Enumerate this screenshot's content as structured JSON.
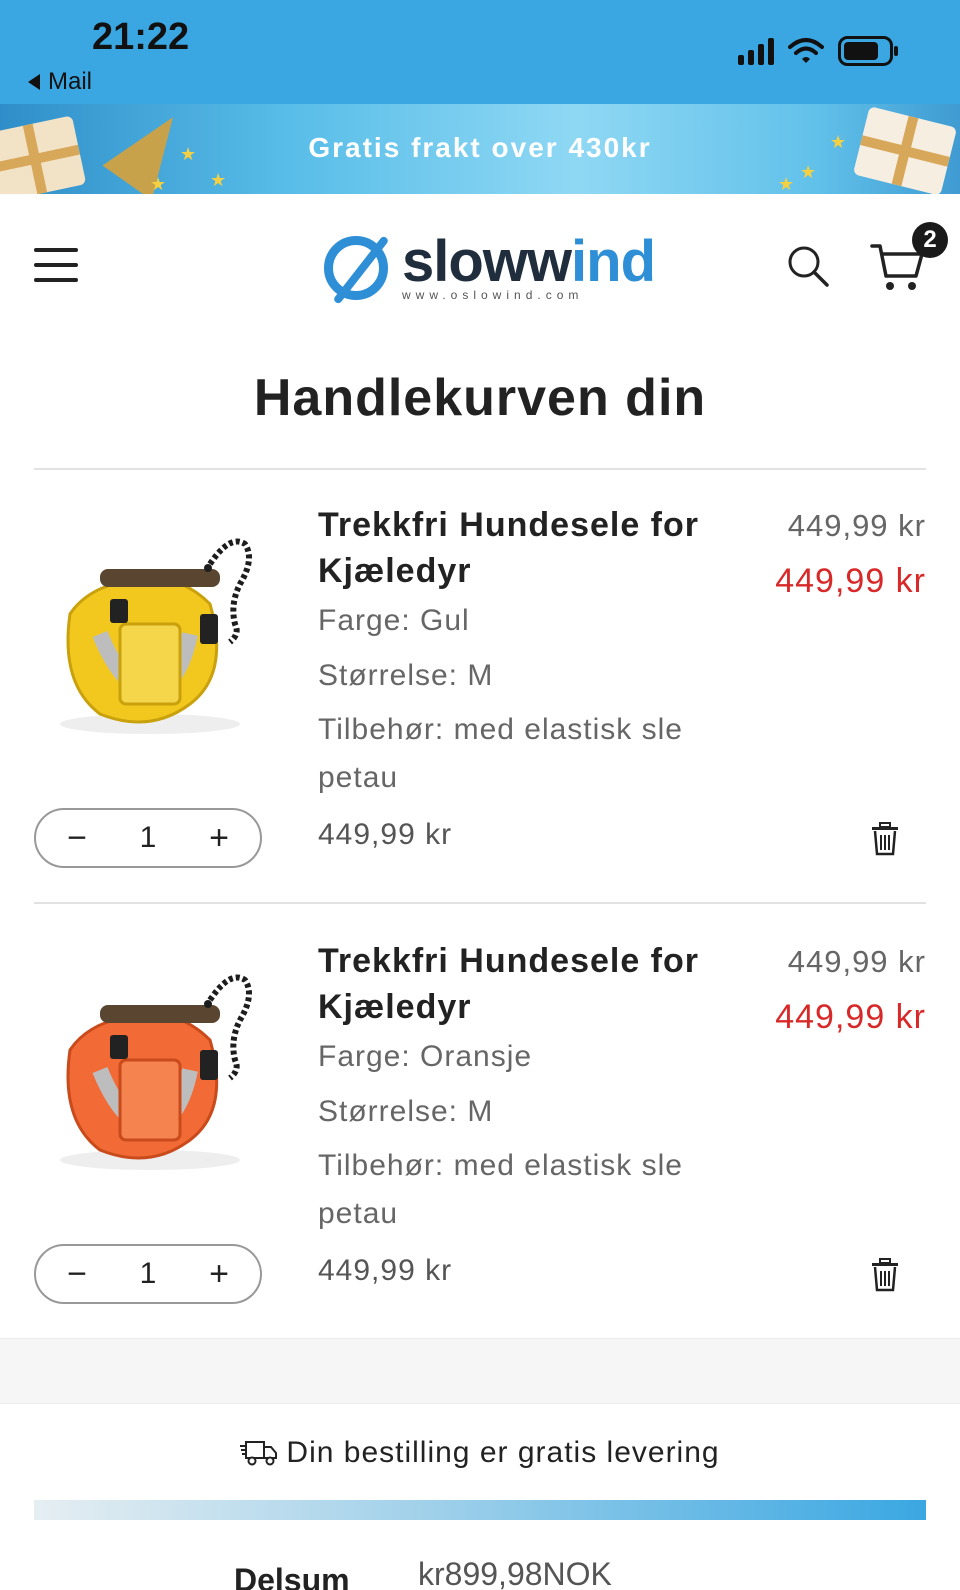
{
  "status_bar": {
    "time": "21:22",
    "back_app": "Mail"
  },
  "promo": {
    "text": "Gratis frakt over 430kr"
  },
  "header": {
    "logo_word_a": "slow",
    "logo_word_b": "ind",
    "logo_sub": "www.oslowind.com",
    "cart_count": "2"
  },
  "page": {
    "title": "Handlekurven din"
  },
  "items": [
    {
      "title": "Trekkfri Hundesele for Kjæledyr",
      "color": "Farge: Gul",
      "size": "Størrelse: M",
      "accessory": "Tilbehør: med elastisk sle petau",
      "old_price": "449,99 kr",
      "price": "449,99 kr",
      "quantity": "1",
      "line_total": "449,99 kr",
      "product_color": "#f2c81e"
    },
    {
      "title": "Trekkfri Hundesele for Kjæledyr",
      "color": "Farge: Oransje",
      "size": "Størrelse: M",
      "accessory": "Tilbehør: med elastisk sle petau",
      "old_price": "449,99 kr",
      "price": "449,99 kr",
      "quantity": "1",
      "line_total": "449,99 kr",
      "product_color": "#f26a35"
    }
  ],
  "qty_controls": {
    "minus": "−",
    "plus": "+"
  },
  "shipping": {
    "text": "Din bestilling er gratis levering",
    "progress": 1.0
  },
  "summary": {
    "subtotal_label": "Delsum",
    "subtotal_value": "kr899,98NOK"
  },
  "colors": {
    "accent": "#3aa7e2",
    "sale_price": "#d82828"
  }
}
